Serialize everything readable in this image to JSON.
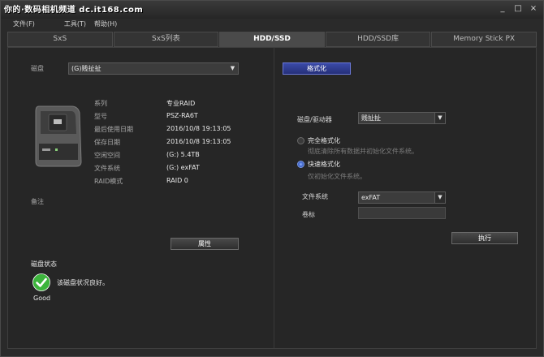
{
  "watermark": "你的·数码相机频道 dc.it168.com",
  "window_controls": [
    "_",
    "□",
    "×"
  ],
  "menu": [
    "文件(F)",
    "工具(T)",
    "帮助(H)"
  ],
  "tabs": [
    "SxS",
    "SxS列表",
    "HDD/SSD",
    "HDD/SSD库",
    "Memory Stick PX"
  ],
  "active_tab": "HDD/SSD",
  "left": {
    "disk_label": "磁盘",
    "disk_value": "(G)贱扯扯",
    "info": [
      {
        "label": "系列",
        "value": "专业RAID"
      },
      {
        "label": "型号",
        "value": "PSZ-RA6T"
      },
      {
        "label": "最后使用日期",
        "value": "2016/10/8 19:13:05"
      },
      {
        "label": "保存日期",
        "value": "2016/10/8 19:13:05"
      },
      {
        "label": "空闲空间",
        "value": "(G:) 5.4TB"
      },
      {
        "label": "文件系统",
        "value": "(G:) exFAT"
      },
      {
        "label": "RAID模式",
        "value": "RAID 0"
      }
    ],
    "notes_label": "备注",
    "properties_button": "属性",
    "status_title": "磁盘状态",
    "status_message": "该磁盘状况良好。",
    "status_word": "Good",
    "status_color": "#3cb43c"
  },
  "right": {
    "format_button": "格式化",
    "drive_label": "磁盘/驱动器",
    "drive_value": "贱扯扯",
    "full_format_label": "完全格式化",
    "full_format_desc": "彻底清除所有数据并初始化文件系统。",
    "quick_format_label": "快速格式化",
    "quick_format_desc": "仅初始化文件系统。",
    "quick_format_selected": true,
    "filesystem_label": "文件系统",
    "filesystem_value": "exFAT",
    "volume_label": "卷标",
    "volume_value": "",
    "execute_button": "执行"
  },
  "colors": {
    "accent_button": "#2f3c98",
    "radio_selected": "#4a72d8"
  }
}
